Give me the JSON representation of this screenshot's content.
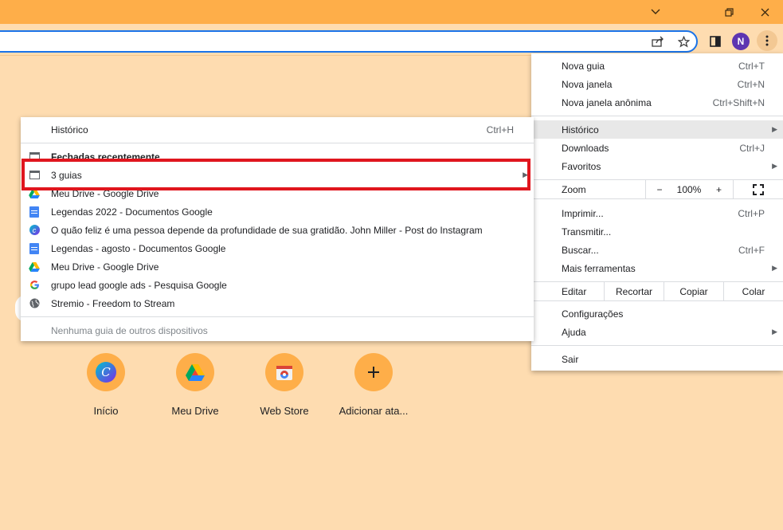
{
  "window": {
    "controls": {
      "minimize_icon": "chevron-down-icon",
      "restore_icon": "restore-icon",
      "close_icon": "close-icon"
    }
  },
  "toolbar": {
    "icons": [
      "share-icon",
      "star-icon",
      "side-panel-icon"
    ],
    "avatar_initial": "N"
  },
  "shortcuts": [
    {
      "label": "Início",
      "icon": "canva-icon"
    },
    {
      "label": "Meu Drive",
      "icon": "google-drive-icon"
    },
    {
      "label": "Web Store",
      "icon": "web-store-icon"
    },
    {
      "label": "Adicionar ata...",
      "icon": "plus-icon"
    }
  ],
  "menu": {
    "new_tab": {
      "label": "Nova guia",
      "shortcut": "Ctrl+T"
    },
    "new_window": {
      "label": "Nova janela",
      "shortcut": "Ctrl+N"
    },
    "incognito": {
      "label": "Nova janela anônima",
      "shortcut": "Ctrl+Shift+N"
    },
    "history": {
      "label": "Histórico"
    },
    "downloads": {
      "label": "Downloads",
      "shortcut": "Ctrl+J"
    },
    "bookmarks": {
      "label": "Favoritos"
    },
    "zoom": {
      "label": "Zoom",
      "minus": "−",
      "value": "100%",
      "plus": "+"
    },
    "print": {
      "label": "Imprimir...",
      "shortcut": "Ctrl+P"
    },
    "cast": {
      "label": "Transmitir..."
    },
    "find": {
      "label": "Buscar...",
      "shortcut": "Ctrl+F"
    },
    "more_tools": {
      "label": "Mais ferramentas"
    },
    "edit": {
      "label": "Editar",
      "cut": "Recortar",
      "copy": "Copiar",
      "paste": "Colar"
    },
    "settings": {
      "label": "Configurações"
    },
    "help": {
      "label": "Ajuda"
    },
    "exit": {
      "label": "Sair"
    }
  },
  "history_submenu": {
    "history": {
      "label": "Histórico",
      "shortcut": "Ctrl+H"
    },
    "recently_closed": "Fechadas recentemente",
    "three_tabs": "3 guias",
    "items": [
      {
        "label": "Meu Drive - Google Drive",
        "icon": "google-drive-icon"
      },
      {
        "label": "Legendas 2022 - Documentos Google",
        "icon": "google-docs-icon"
      },
      {
        "label": "O quão feliz é uma pessoa depende da profundidade de sua gratidão. John Miller - Post do Instagram",
        "icon": "canva-icon"
      },
      {
        "label": "Legendas - agosto - Documentos Google",
        "icon": "google-docs-icon"
      },
      {
        "label": "Meu Drive - Google Drive",
        "icon": "google-drive-icon"
      },
      {
        "label": "grupo lead google ads - Pesquisa Google",
        "icon": "google-icon"
      },
      {
        "label": "Stremio - Freedom to Stream",
        "icon": "globe-icon"
      }
    ],
    "no_other_devices": "Nenhuma guia de outros dispositivos"
  },
  "colors": {
    "titlebar": "#feae49",
    "page_background": "#fedcb0",
    "highlight_border": "#e0161e",
    "focus_ring": "#1a73e8"
  }
}
